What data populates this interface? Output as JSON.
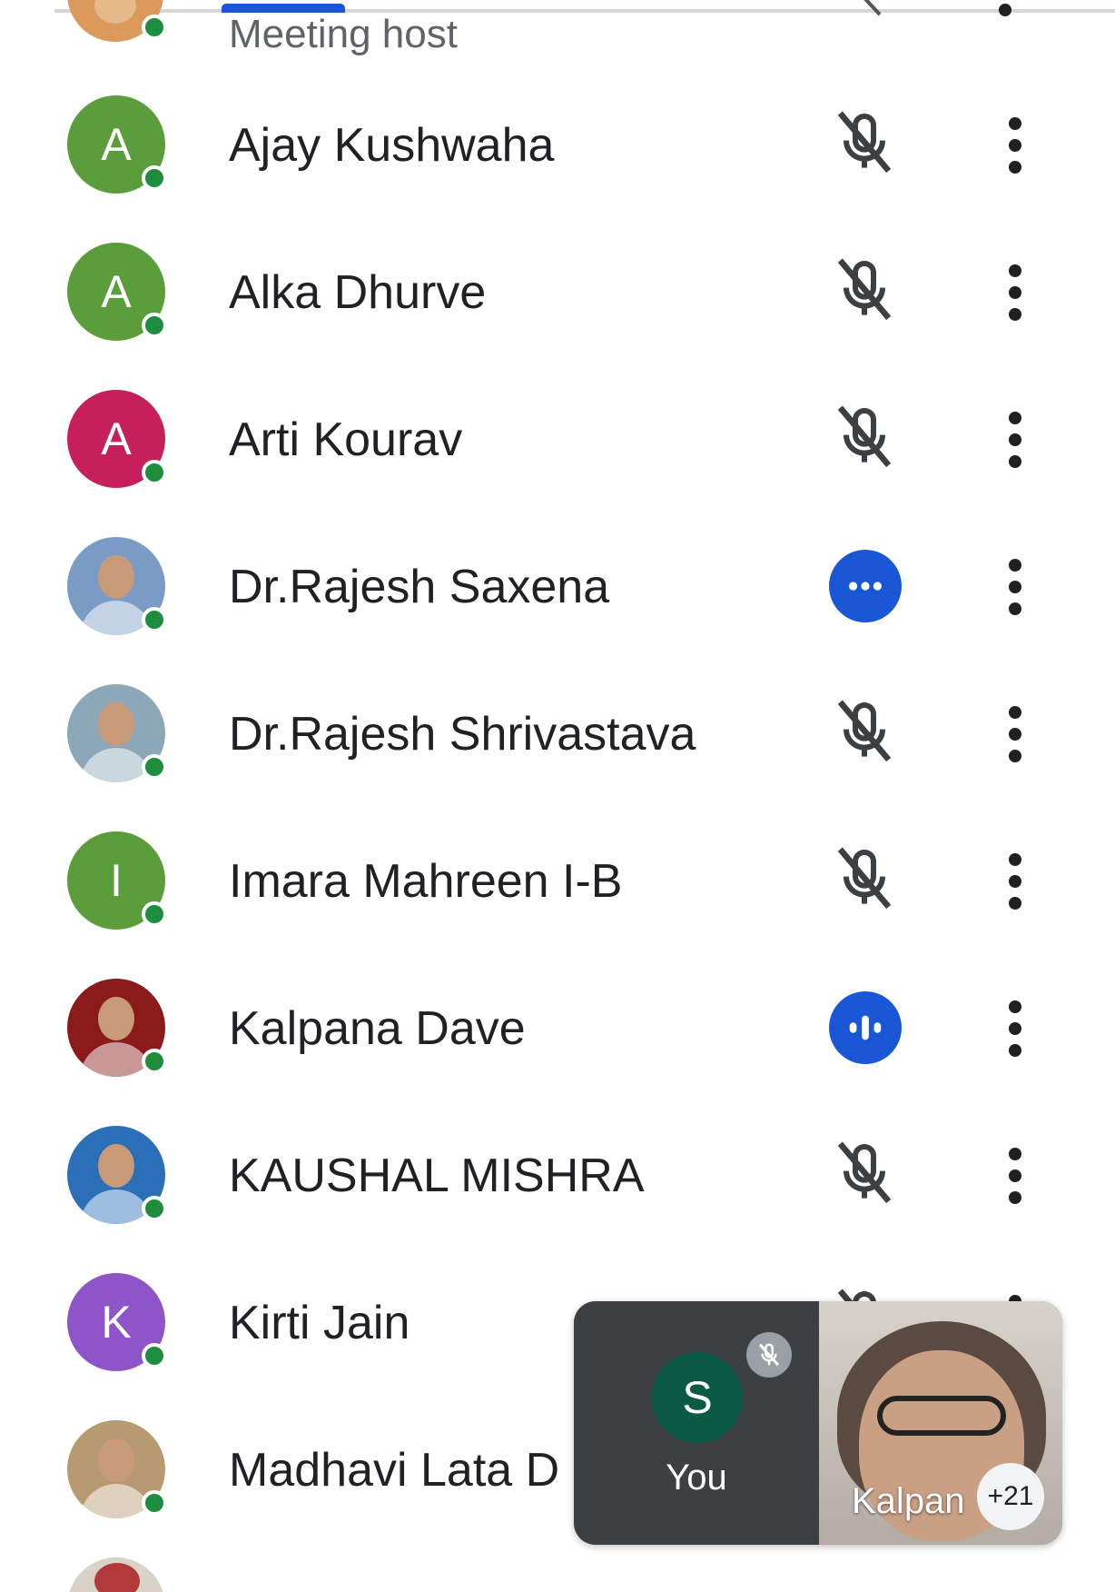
{
  "host": {
    "subtitle": "Meeting host"
  },
  "participants": [
    {
      "name": "Ajay Kushwaha",
      "initial": "A",
      "avatar_color": "#5b9d3a",
      "status": "muted"
    },
    {
      "name": "Alka Dhurve",
      "initial": "A",
      "avatar_color": "#5b9d3a",
      "status": "muted"
    },
    {
      "name": "Arti Kourav",
      "initial": "A",
      "avatar_color": "#c5205a",
      "status": "muted"
    },
    {
      "name": "Dr.Rajesh Saxena",
      "initial": "",
      "avatar_color": "#7a9cc4",
      "status": "unmuted-idle"
    },
    {
      "name": "Dr.Rajesh Shrivastava",
      "initial": "",
      "avatar_color": "#8ca7b8",
      "status": "muted"
    },
    {
      "name": "Imara Mahreen I-B",
      "initial": "I",
      "avatar_color": "#5b9d3a",
      "status": "muted"
    },
    {
      "name": "Kalpana Dave",
      "initial": "",
      "avatar_color": "#8b1a1a",
      "status": "speaking"
    },
    {
      "name": "KAUSHAL MISHRA",
      "initial": "",
      "avatar_color": "#2a6fb8",
      "status": "muted"
    },
    {
      "name": "Kirti Jain",
      "initial": "K",
      "avatar_color": "#8e55c9",
      "status": "muted"
    },
    {
      "name": "Madhavi Lata D",
      "initial": "",
      "avatar_color": "#b89a70",
      "status": "muted"
    }
  ],
  "pip": {
    "self_initial": "S",
    "self_label": "You",
    "self_avatar_color": "#0b5a45",
    "speaker_label": "Kalpan",
    "extra_count": "+21"
  },
  "colors": {
    "accent": "#1a57d6",
    "presence": "#1e8e3e"
  },
  "icons": [
    "mic-off-icon",
    "more-vert-icon",
    "speaking-indicator-icon",
    "idle-audio-icon"
  ]
}
